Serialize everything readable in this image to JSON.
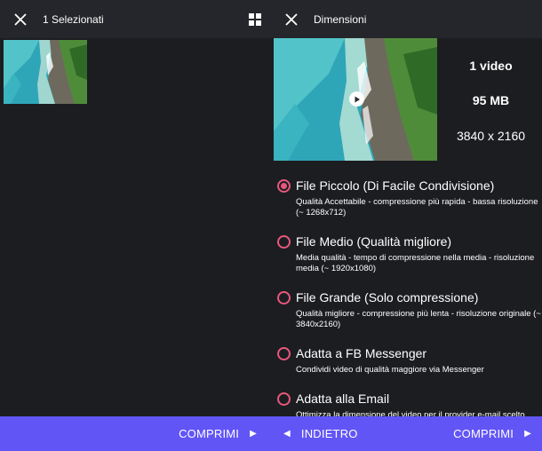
{
  "left": {
    "title": "1 Selezionati",
    "compress_label": "COMPRIMI"
  },
  "right": {
    "title": "Dimensioni",
    "stats": {
      "count": "1 video",
      "size": "95 MB",
      "resolution": "3840 x 2160"
    },
    "options": [
      {
        "title": "File Piccolo (Di Facile Condivisione)",
        "desc": "Qualità Accettabile - compressione più rapida - bassa risoluzione (~ 1268x712)",
        "checked": true
      },
      {
        "title": "File Medio (Qualità migliore)",
        "desc": "Media qualità - tempo di compressione nella media - risoluzione media (~ 1920x1080)",
        "checked": false
      },
      {
        "title": "File Grande (Solo compressione)",
        "desc": "Qualità migliore - compressione più lenta - risoluzione originale (~ 3840x2160)",
        "checked": false
      },
      {
        "title": "Adatta a FB Messenger",
        "desc": "Condividi video di qualità maggiore via Messenger",
        "checked": false
      },
      {
        "title": "Adatta alla Email",
        "desc": "Ottimizza la dimensione del video per il provider e-mail scelto",
        "checked": false
      }
    ],
    "back_label": "INDIETRO",
    "compress_label": "COMPRIMI"
  },
  "colors": {
    "accent_bar": "#6255f6",
    "radio": "#e8577c",
    "background": "#1c1d21",
    "topbar": "#25262b"
  },
  "icons": {
    "close": "close-icon",
    "grid": "grid-icon",
    "play": "play-icon",
    "arrow_left": "arrow-left-icon",
    "arrow_right": "arrow-right-icon"
  }
}
